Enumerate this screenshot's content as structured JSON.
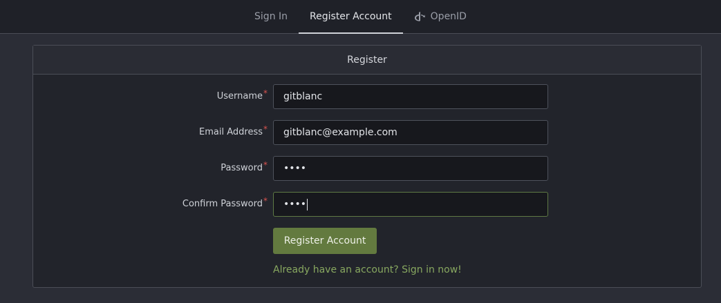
{
  "nav": {
    "tabs": [
      {
        "label": "Sign In"
      },
      {
        "label": "Register Account"
      },
      {
        "label": "OpenID",
        "icon": "openid-icon"
      }
    ]
  },
  "card": {
    "title": "Register"
  },
  "form": {
    "username": {
      "label": "Username",
      "value": "gitblanc"
    },
    "email": {
      "label": "Email Address",
      "value": "gitblanc@example.com"
    },
    "password": {
      "label": "Password",
      "value": "••••"
    },
    "confirm": {
      "label": "Confirm Password",
      "value": "••••"
    },
    "required_mark": "*",
    "submit_label": "Register Account",
    "signin_link": "Already have an account? Sign in now!"
  },
  "colors": {
    "primary_button": "#637a3f",
    "link": "#88a860",
    "required": "#d9534f"
  }
}
